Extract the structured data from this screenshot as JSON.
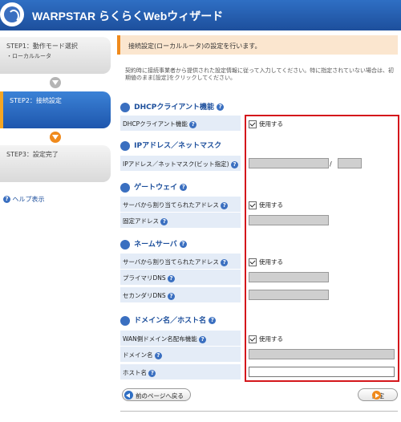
{
  "header": {
    "title": "WARPSTAR らくらくWebウィザード"
  },
  "sidebar": {
    "steps": [
      {
        "title": "STEP1：動作モード選択",
        "sub": "・ローカルルータ"
      },
      {
        "title": "STEP2：接続設定"
      },
      {
        "title": "STEP3：設定完了"
      }
    ],
    "help": "ヘルプ表示"
  },
  "main": {
    "banner": "接続設定(ローカルルータ)の設定を行います。",
    "description": "契約時に接続事業者から提供された設定情報に従って入力してください。特に指定されていない場合は、初期値のまま[設定]をクリックしてください。",
    "sections": {
      "dhcp": {
        "title": "DHCPクライアント機能",
        "rows": [
          {
            "label": "DHCPクライアント機能",
            "checkbox": "使用する"
          }
        ]
      },
      "ip": {
        "title": "IPアドレス／ネットマスク",
        "rows": [
          {
            "label": "IPアドレス／ネットマスク(ビット指定)",
            "separator": "/"
          }
        ]
      },
      "gateway": {
        "title": "ゲートウェイ",
        "rows": [
          {
            "label": "サーバから割り当てられたアドレス",
            "checkbox": "使用する"
          },
          {
            "label": "固定アドレス"
          }
        ]
      },
      "nameserver": {
        "title": "ネームサーバ",
        "rows": [
          {
            "label": "サーバから割り当てられたアドレス",
            "checkbox": "使用する"
          },
          {
            "label": "プライマリDNS"
          },
          {
            "label": "セカンダリDNS"
          }
        ]
      },
      "domain": {
        "title": "ドメイン名／ホスト名",
        "rows": [
          {
            "label": "WAN側ドメイン名配布機能",
            "checkbox": "使用する"
          },
          {
            "label": "ドメイン名"
          },
          {
            "label": "ホスト名"
          }
        ]
      }
    },
    "buttons": {
      "back": "前のページへ戻る",
      "next": "設定"
    }
  },
  "colors": {
    "header": "#2f6fc4",
    "accent": "#f08a1c",
    "highlight_box": "#d4161b",
    "label_bg": "#e4ecf7"
  }
}
